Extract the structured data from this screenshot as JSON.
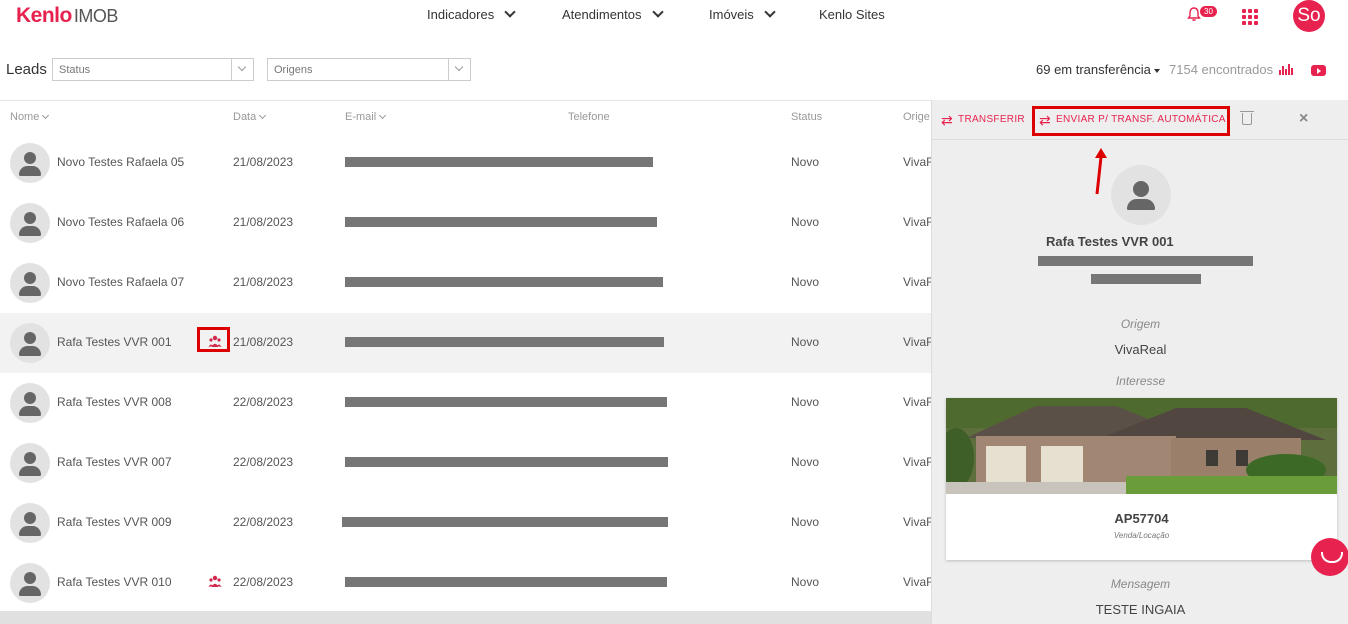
{
  "app": {
    "brand": "Kenlo",
    "product": "IMOB"
  },
  "nav": [
    {
      "label": "Indicadores",
      "dropdown": true
    },
    {
      "label": "Atendimentos",
      "dropdown": true
    },
    {
      "label": "Imóveis",
      "dropdown": true
    },
    {
      "label": "Kenlo Sites",
      "dropdown": false
    }
  ],
  "notifications": {
    "count": "30"
  },
  "user": {
    "initials": "So"
  },
  "filters": {
    "title": "Leads",
    "status_placeholder": "Status",
    "origins_placeholder": "Origens",
    "transfer_text": "69 em transferência",
    "found_text": "7154 encontrados"
  },
  "table": {
    "headers": {
      "name": "Nome",
      "date": "Data",
      "email": "E-mail",
      "phone": "Telefone",
      "status": "Status",
      "origin": "Orige"
    },
    "rows": [
      {
        "name": "Novo Testes Rafaela 05",
        "date": "21/08/2023",
        "status": "Novo",
        "origin": "VivaR",
        "group": false
      },
      {
        "name": "Novo Testes Rafaela 06",
        "date": "21/08/2023",
        "status": "Novo",
        "origin": "VivaR",
        "group": false
      },
      {
        "name": "Novo Testes Rafaela 07",
        "date": "21/08/2023",
        "status": "Novo",
        "origin": "VivaR",
        "group": false
      },
      {
        "name": "Rafa Testes VVR 001",
        "date": "21/08/2023",
        "status": "Novo",
        "origin": "VivaR",
        "group": true,
        "selected": true
      },
      {
        "name": "Rafa Testes VVR 008",
        "date": "22/08/2023",
        "status": "Novo",
        "origin": "VivaR",
        "group": false
      },
      {
        "name": "Rafa Testes VVR 007",
        "date": "22/08/2023",
        "status": "Novo",
        "origin": "VivaR",
        "group": false
      },
      {
        "name": "Rafa Testes VVR 009",
        "date": "22/08/2023",
        "status": "Novo",
        "origin": "VivaR",
        "group": false
      },
      {
        "name": "Rafa Testes VVR 010",
        "date": "22/08/2023",
        "status": "Novo",
        "origin": "VivaR",
        "group": true
      }
    ]
  },
  "panel": {
    "transfer_label": "TRANSFERIR",
    "auto_transfer_label": "ENVIAR P/ TRANSF. AUTOMÁTICA",
    "lead_name": "Rafa Testes VVR 001",
    "origin_label": "Origem",
    "origin_value": "VivaReal",
    "interest_label": "Interesse",
    "property_code": "AP57704",
    "property_type": "Venda/Locação",
    "message_label": "Mensagem",
    "message_value": "TESTE INGAIA"
  },
  "colors": {
    "accent": "#e8224f",
    "highlight": "#dd0000",
    "redaction": "#767676"
  }
}
